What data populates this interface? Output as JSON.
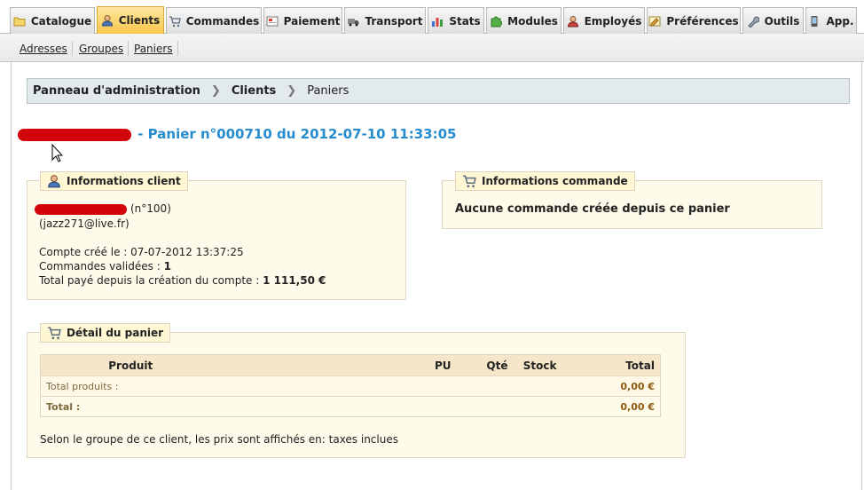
{
  "tabs": [
    {
      "label": "Catalogue",
      "icon": "folder-icon",
      "active": false
    },
    {
      "label": "Clients",
      "icon": "user-icon",
      "active": true
    },
    {
      "label": "Commandes",
      "icon": "cart-icon",
      "active": false
    },
    {
      "label": "Paiement",
      "icon": "payment-icon",
      "active": false
    },
    {
      "label": "Transport",
      "icon": "truck-icon",
      "active": false
    },
    {
      "label": "Stats",
      "icon": "bar-chart-icon",
      "active": false
    },
    {
      "label": "Modules",
      "icon": "puzzle-icon",
      "active": false
    },
    {
      "label": "Employés",
      "icon": "employee-icon",
      "active": false
    },
    {
      "label": "Préférences",
      "icon": "preferences-icon",
      "active": false
    },
    {
      "label": "Outils",
      "icon": "wrench-icon",
      "active": false
    },
    {
      "label": "App.",
      "icon": "phone-icon",
      "active": false
    }
  ],
  "submenu": [
    "Adresses",
    "Groupes",
    "Paniers"
  ],
  "breadcrumb": [
    "Panneau d'administration",
    "Clients",
    "Paniers"
  ],
  "page_title": "- Panier n°000710 du 2012-07-10 11:33:05",
  "client_box": {
    "legend": "Informations client",
    "client_number": "(n°100)",
    "email": "(jazz271@live.fr)",
    "created": "Compte créé le : 07-07-2012 13:37:25",
    "orders_label": "Commandes validées : ",
    "orders_value": "1",
    "paid_label": "Total payé depuis la création du compte : ",
    "paid_value": "1 111,50 €"
  },
  "order_box": {
    "legend": "Informations commande",
    "message": "Aucune commande créée depuis ce panier"
  },
  "cart_box": {
    "legend": "Détail du panier",
    "columns": [
      "Produit",
      "PU",
      "Qté",
      "Stock",
      "Total"
    ],
    "rows": [
      {
        "label": "Total produits :",
        "total": "0,00 €"
      },
      {
        "label": "Total :",
        "total": "0,00 €"
      }
    ],
    "note": "Selon le groupe de ce client, les prix sont affichés en: taxes inclues"
  },
  "colors": {
    "title_blue": "#268ccd",
    "active_tab": "#f8c64a",
    "box_bg": "#fffbea",
    "redaction": "#d2060a"
  }
}
